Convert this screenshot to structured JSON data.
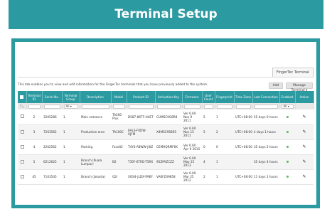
{
  "banner": {
    "title": "Terminal Setup"
  },
  "tab": {
    "label": "FingerTec Terminal"
  },
  "description": "This tab enables you to view and edit information for the FingerTec terminals that you have previously added to the system.",
  "buttons": {
    "add": "Add",
    "manage": "Manage Terminal ▾"
  },
  "table": {
    "headers": [
      "Terminal ID",
      "Serial No.",
      "Terminal Group",
      "Description",
      "Model",
      "Product ID",
      "Activation Key",
      "Firmware",
      "User Count",
      "Fingerprint",
      "Time Zone",
      "Last Connection",
      "Enabled",
      "Action"
    ],
    "filters": {
      "group": "All ▾",
      "enabled": "All ▾"
    },
    "rows": [
      {
        "id": "2",
        "serial": "3205286",
        "group": "1",
        "description": "Main entrance",
        "model": "TA200 Plus",
        "product_id": "D587-86TF-H4ET",
        "activation": "CUMSC9G8R8",
        "firmware": "Ver 6.60 Nov 9 2011",
        "users": "5",
        "fingerprint": "1",
        "timezone": "UTC+08:00",
        "last": "55 days 0 hours"
      },
      {
        "id": "3",
        "serial": "7203562",
        "group": "1",
        "description": "Production area",
        "model": "TA100C",
        "product_id": "8ALS-FKDW-UJFM",
        "activation": "X4MSC9S8ES",
        "firmware": "Ver 6.60 Nov 15 2011",
        "users": "5",
        "fingerprint": "2",
        "timezone": "UTC+08:00",
        "last": "4 days 1 hours"
      },
      {
        "id": "4",
        "serial": "2202562",
        "group": "1",
        "description": "Packing",
        "model": "Face02",
        "product_id": "T4Y0-A8WW-J4IZ",
        "activation": "CEMHQRMF6K",
        "firmware": "Ver 6.60 Apr 9 2015",
        "users": "0",
        "fingerprint": "0",
        "timezone": "UTC+08:00",
        "last": "35 days 5 hours"
      },
      {
        "id": "5",
        "serial": "6212625",
        "group": "1",
        "description": "Branch (Kuala Lumpur)",
        "model": "B2",
        "product_id": "T35F-6TRD-T5RX",
        "activation": "95ZPAZCZZ",
        "firmware": "Ver 6.60 May 25 2013",
        "users": "4",
        "fingerprint": "1",
        "timezone": "",
        "last": "35 days 4 hours"
      },
      {
        "id": "45",
        "serial": "7103545",
        "group": "1",
        "description": "Branch (Jakarta)",
        "model": "Q2i",
        "product_id": "XQS4-JLDX-YMEF",
        "activation": "VA6FZ49858",
        "firmware": "Ver 6.60 Mar 25 2012",
        "users": "2",
        "fingerprint": "1",
        "timezone": "UTC+08:00",
        "last": "11 days 1 hours"
      }
    ]
  },
  "colors": {
    "accent": "#2c9aa1",
    "enabled_dot": "#5cb85c"
  }
}
